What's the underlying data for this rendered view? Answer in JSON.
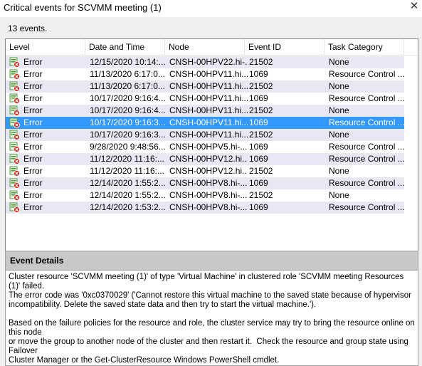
{
  "window": {
    "title": "Critical events for SCVMM meeting (1)",
    "close_glyph": "✕"
  },
  "summary": {
    "count_text": "13 events."
  },
  "list": {
    "columns": [
      "Level",
      "Date and Time",
      "Node",
      "Event ID",
      "Task Category"
    ],
    "rows": [
      [
        "Error",
        "12/15/2020 10:14:...",
        "CNSH-00HPV22.hi-...",
        "21502",
        "None"
      ],
      [
        "Error",
        "11/13/2020 6:17:0...",
        "CNSH-00HPV11.hi...",
        "1069",
        "Resource Control ..."
      ],
      [
        "Error",
        "11/13/2020 6:17:0...",
        "CNSH-00HPV11.hi...",
        "21502",
        "None"
      ],
      [
        "Error",
        "10/17/2020 9:16:4...",
        "CNSH-00HPV11.hi...",
        "1069",
        "Resource Control ..."
      ],
      [
        "Error",
        "10/17/2020 9:16:4...",
        "CNSH-00HPV11.hi...",
        "21502",
        "None"
      ],
      [
        "Error",
        "10/17/2020 9:16:3...",
        "CNSH-00HPV11.hi...",
        "1069",
        "Resource Control ..."
      ],
      [
        "Error",
        "10/17/2020 9:16:3...",
        "CNSH-00HPV11.hi...",
        "21502",
        "None"
      ],
      [
        "Error",
        "9/28/2020 9:48:56...",
        "CNSH-00HPV5.hi-...",
        "1069",
        "Resource Control ..."
      ],
      [
        "Error",
        "11/12/2020 11:16:...",
        "CNSH-00HPV12.hi...",
        "1069",
        "Resource Control ..."
      ],
      [
        "Error",
        "11/12/2020 11:16:...",
        "CNSH-00HPV12.hi...",
        "21502",
        "None"
      ],
      [
        "Error",
        "12/14/2020 1:55:2...",
        "CNSH-00HPV8.hi-...",
        "1069",
        "Resource Control ..."
      ],
      [
        "Error",
        "12/14/2020 1:55:2...",
        "CNSH-00HPV8.hi-...",
        "21502",
        "None"
      ],
      [
        "Error",
        "12/14/2020 1:53:2...",
        "CNSH-00HPV8.hi-...",
        "1069",
        "Resource Control ..."
      ]
    ],
    "selected_index": 5
  },
  "details": {
    "title": "Event Details",
    "text": "Cluster resource 'SCVMM meeting (1)' of type 'Virtual Machine' in clustered role 'SCVMM meeting Resources (1)' failed.\nThe error code was '0xc0370029' ('Cannot restore this virtual machine to the saved state because of hypervisor\nincompatibility. Delete the saved state data and then try to start the virtual machine.').\n\nBased on the failure policies for the resource and role, the cluster service may try to bring the resource online on this node\nor move the group to another node of the cluster and then restart it.  Check the resource and group state using Failover\nCluster Manager or the Get-ClusterResource Windows PowerShell cmdlet."
  },
  "colors": {
    "selected": "#3399ff",
    "alt_row": "#e8e8f4",
    "error_red": "#d9261c",
    "server_green": "#4f9a3a"
  },
  "icons": {
    "error_row": "server-error-icon",
    "close": "close-icon"
  }
}
